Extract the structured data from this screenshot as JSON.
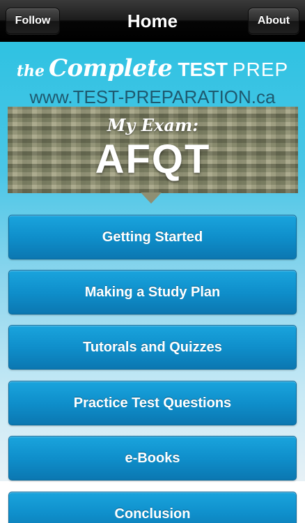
{
  "navbar": {
    "left_button": "Follow",
    "title": "Home",
    "right_button": "About"
  },
  "logo": {
    "the": "the",
    "complete": "Complete",
    "test": "TEST",
    "prep": "PREP",
    "url": "www.TEST-PREPARATION.ca"
  },
  "banner": {
    "subtitle": "My Exam:",
    "exam": "AFQT"
  },
  "menu": {
    "items": [
      "Getting Started",
      "Making a Study Plan",
      "Tutorals and Quizzes",
      "Practice Test Questions",
      "e-Books",
      "Conclusion"
    ]
  },
  "colors": {
    "navbar": "#111111",
    "accent_gradient_top": "#2fc2e2",
    "menu_button": "#0f8fcb",
    "url_text": "#1e5a70",
    "banner_camo": "#8e8f73"
  }
}
